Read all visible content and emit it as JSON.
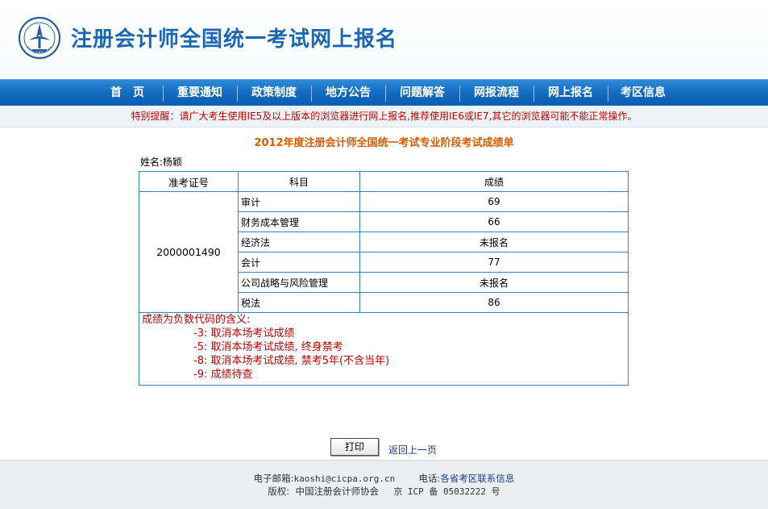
{
  "site": {
    "title": "注册会计师全国统一考试网上报名"
  },
  "nav": [
    "首　页",
    "重要通知",
    "政策制度",
    "地方公告",
    "问题解答",
    "网报流程",
    "网上报名",
    "考区信息"
  ],
  "notice": "特别提醒：请广大考生使用IE5及以上版本的浏览器进行网上报名,推荐使用IE6或IE7,其它的浏览器可能不能正常操作。",
  "report": {
    "title": "2012年度注册会计师全国统一考试专业阶段考试成绩单",
    "name_label": "姓名:杨颖",
    "headers": {
      "id": "准考证号",
      "subject": "科目",
      "score": "成绩"
    },
    "exam_id": "2000001490",
    "rows": [
      {
        "subject": "审计",
        "score": "69"
      },
      {
        "subject": "财务成本管理",
        "score": "66"
      },
      {
        "subject": "经济法",
        "score": "未报名"
      },
      {
        "subject": "会计",
        "score": "77"
      },
      {
        "subject": "公司战略与风险管理",
        "score": "未报名"
      },
      {
        "subject": "税法",
        "score": "86"
      }
    ],
    "legend_title": "成绩为负数代码的含义:",
    "legend_items": [
      "-3: 取消本场考试成绩",
      "-5: 取消本场考试成绩, 终身禁考",
      "-8: 取消本场考试成绩, 禁考5年(不含当年)",
      "-9: 成绩待查"
    ]
  },
  "actions": {
    "print": "打印",
    "back": "返回上一页"
  },
  "footer": {
    "email_label": "电子邮箱:",
    "email": "kaoshi@cicpa.org.cn",
    "phone_label": "电话:",
    "phone_link": "各省考区联系信息",
    "copyright_label": "版权:",
    "copyright": "中国注册会计师协会",
    "icp": "京 ICP 备 05032222 号"
  },
  "colors": {
    "nav": "#1168be",
    "title": "#1c67b3",
    "alert": "#c20000",
    "report_title": "#d85c00"
  }
}
